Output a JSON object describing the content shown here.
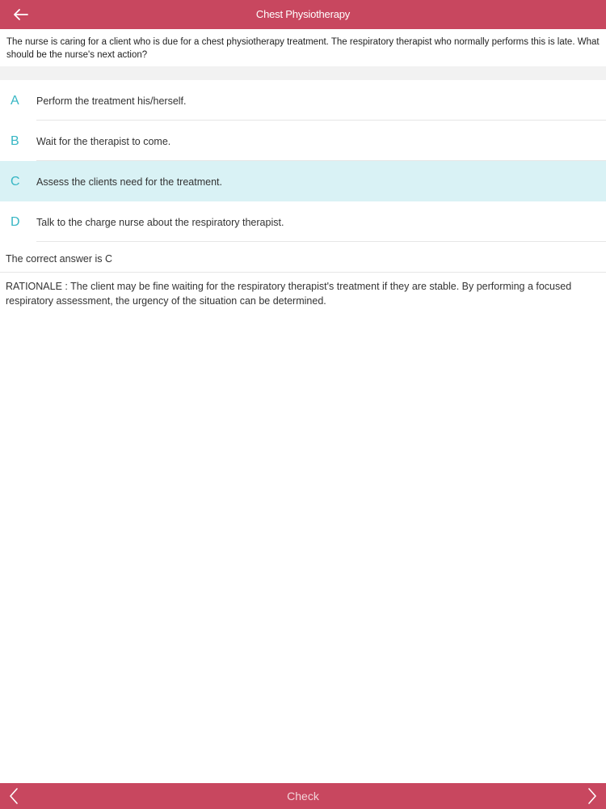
{
  "header": {
    "title": "Chest Physiotherapy",
    "back_icon": "arrow-left-icon"
  },
  "question": {
    "text": "The nurse is caring for a client who is due for a chest physiotherapy treatment. The respiratory therapist who normally performs this is late. What should be the nurse's next action?"
  },
  "options": [
    {
      "letter": "A",
      "text": "Perform the treatment his/herself."
    },
    {
      "letter": "B",
      "text": "Wait for the therapist to come."
    },
    {
      "letter": "C",
      "text": "Assess the clients need for the treatment."
    },
    {
      "letter": "D",
      "text": "Talk to the charge nurse about the respiratory therapist."
    }
  ],
  "selected_option": "C",
  "answer": {
    "text": "The correct answer is C"
  },
  "rationale": {
    "text": "RATIONALE :  The client may be fine waiting for the respiratory therapist's treatment if they are stable.  By performing a focused respiratory assessment, the urgency of the situation can be determined."
  },
  "footer": {
    "check_label": "Check",
    "prev_icon": "chevron-left-icon",
    "next_icon": "chevron-right-icon"
  },
  "colors": {
    "bar": "#c8475f",
    "accent": "#36b6c4",
    "selected_row": "#d9f2f5"
  }
}
